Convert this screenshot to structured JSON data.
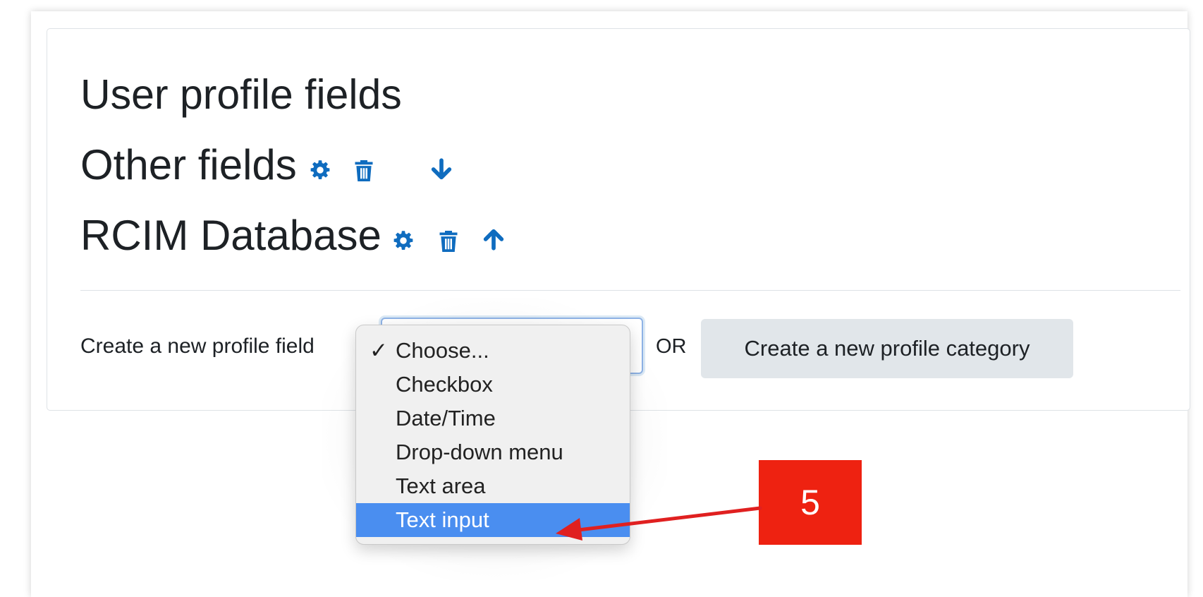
{
  "page": {
    "title": "User profile fields",
    "accent_color": "#0f6cbf"
  },
  "categories": [
    {
      "name": "Other fields",
      "icons": [
        "gear-icon",
        "trash-icon",
        "arrow-down-icon"
      ]
    },
    {
      "name": "RCIM Database",
      "icons": [
        "gear-icon",
        "trash-icon",
        "arrow-up-icon"
      ]
    }
  ],
  "create_field": {
    "label": "Create a new profile field",
    "selected": "Choose...",
    "options": [
      "Choose...",
      "Checkbox",
      "Date/Time",
      "Drop-down menu",
      "Text area",
      "Text input"
    ],
    "highlighted_option": "Text input",
    "check_mark": "✓"
  },
  "or_label": "OR",
  "create_category_button": "Create a new profile category",
  "annotation": {
    "badge_text": "5",
    "badge_color": "#ee2211",
    "arrow_color": "#e02020"
  }
}
